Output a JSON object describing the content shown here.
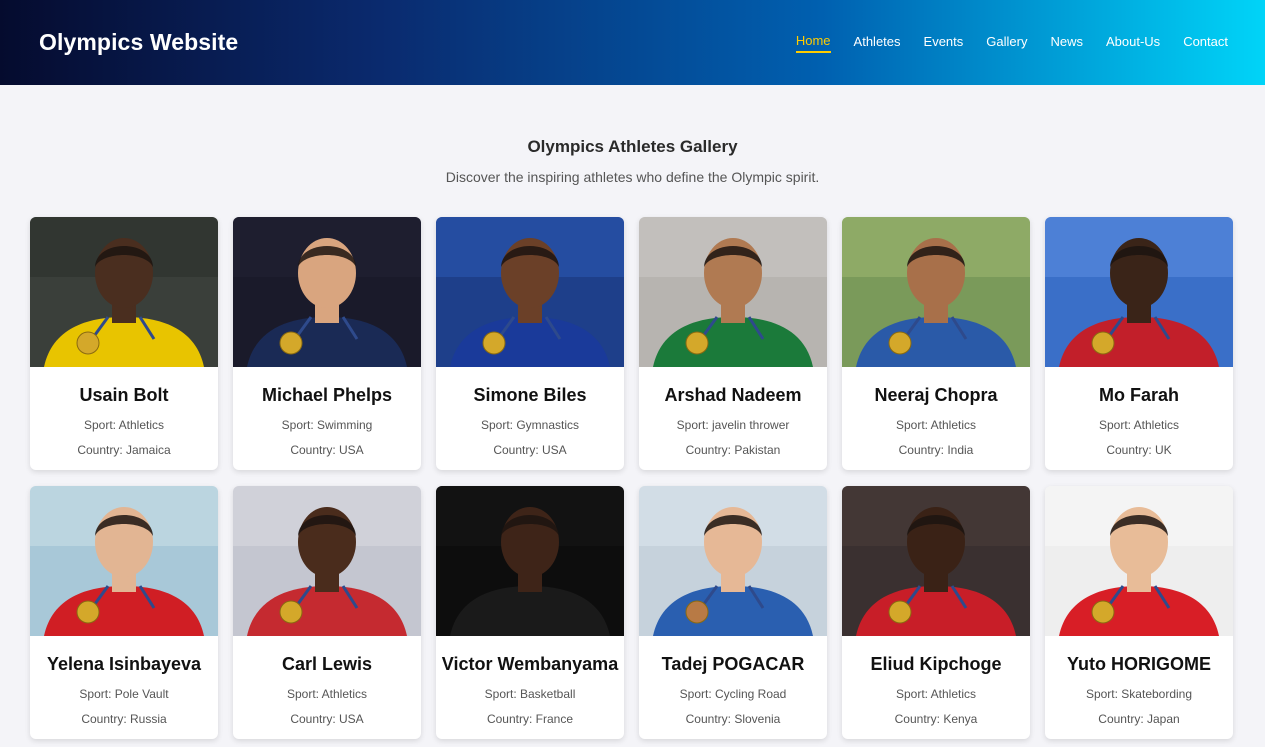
{
  "site": {
    "title": "Olympics Website"
  },
  "nav": [
    {
      "label": "Home",
      "active": true
    },
    {
      "label": "Athletes",
      "active": false
    },
    {
      "label": "Events",
      "active": false
    },
    {
      "label": "Gallery",
      "active": false
    },
    {
      "label": "News",
      "active": false
    },
    {
      "label": "About-Us",
      "active": false
    },
    {
      "label": "Contact",
      "active": false
    }
  ],
  "gallery": {
    "title": "Olympics Athletes Gallery",
    "subtitle": "Discover the inspiring athletes who define the Olympic spirit."
  },
  "athletes": [
    {
      "name": "Usain Bolt",
      "sport": "Sport: Athletics",
      "country": "Country: Jamaica",
      "bg": "#3a3f3a",
      "top": "#2b302b",
      "shirt": "#e8c400",
      "skin": "#4a2e1f",
      "medal": "gold"
    },
    {
      "name": "Michael Phelps",
      "sport": "Sport: Swimming",
      "country": "Country: USA",
      "bg": "#1a1a2a",
      "top": "#222233",
      "shirt": "#1a2a55",
      "skin": "#d9a57f",
      "medal": "gold"
    },
    {
      "name": "Simone Biles",
      "sport": "Sport: Gymnastics",
      "country": "Country: USA",
      "bg": "#1e3f8a",
      "top": "#2a57b0",
      "shirt": "#1a3a9a",
      "skin": "#6b4028",
      "medal": "gold"
    },
    {
      "name": "Arshad Nadeem",
      "sport": "Sport: javelin thrower",
      "country": "Country: Pakistan",
      "bg": "#b7b4b0",
      "top": "#cac7c4",
      "shirt": "#1b7a3a",
      "skin": "#b07a52",
      "medal": "gold"
    },
    {
      "name": "Neeraj Chopra",
      "sport": "Sport: Athletics",
      "country": "Country: India",
      "bg": "#7a9a5a",
      "top": "#9bb56e",
      "shirt": "#2a5aa8",
      "skin": "#a8704a",
      "medal": "gold"
    },
    {
      "name": "Mo Farah",
      "sport": "Sport: Athletics",
      "country": "Country: UK",
      "bg": "#3a6fc8",
      "top": "#5a8ce0",
      "shirt": "#c21f2a",
      "skin": "#3a2418",
      "medal": "gold"
    },
    {
      "name": "Yelena Isinbayeva",
      "sport": "Sport: Pole Vault",
      "country": "Country: Russia",
      "bg": "#a8c8d8",
      "top": "#c8dde6",
      "shirt": "#d01e24",
      "skin": "#e2b593",
      "medal": "gold"
    },
    {
      "name": "Carl Lewis",
      "sport": "Sport: Athletics",
      "country": "Country: USA",
      "bg": "#c4c6d0",
      "top": "#d8d9e0",
      "shirt": "#c52a30",
      "skin": "#4a2c1c",
      "medal": "gold"
    },
    {
      "name": "Victor Wembanyama",
      "sport": "Sport: Basketball",
      "country": "Country: France",
      "bg": "#0d0d0d",
      "top": "#161616",
      "shirt": "#1a1a1a",
      "skin": "#3e2418",
      "medal": "none"
    },
    {
      "name": "Tadej POGACAR",
      "sport": "Sport: Cycling Road",
      "country": "Country: Slovenia",
      "bg": "#c6d2dc",
      "top": "#dbe4ec",
      "shirt": "#2a5fb0",
      "skin": "#e6b896",
      "medal": "bronze"
    },
    {
      "name": "Eliud Kipchoge",
      "sport": "Sport: Athletics",
      "country": "Country: Kenya",
      "bg": "#3a3030",
      "top": "#4a3c38",
      "shirt": "#c81e28",
      "skin": "#3a2216",
      "medal": "gold"
    },
    {
      "name": "Yuto HORIGOME",
      "sport": "Sport: Skatebording",
      "country": "Country: Japan",
      "bg": "#eeeeee",
      "top": "#f8f8f8",
      "shirt": "#d81e26",
      "skin": "#e8bc98",
      "medal": "gold"
    }
  ]
}
